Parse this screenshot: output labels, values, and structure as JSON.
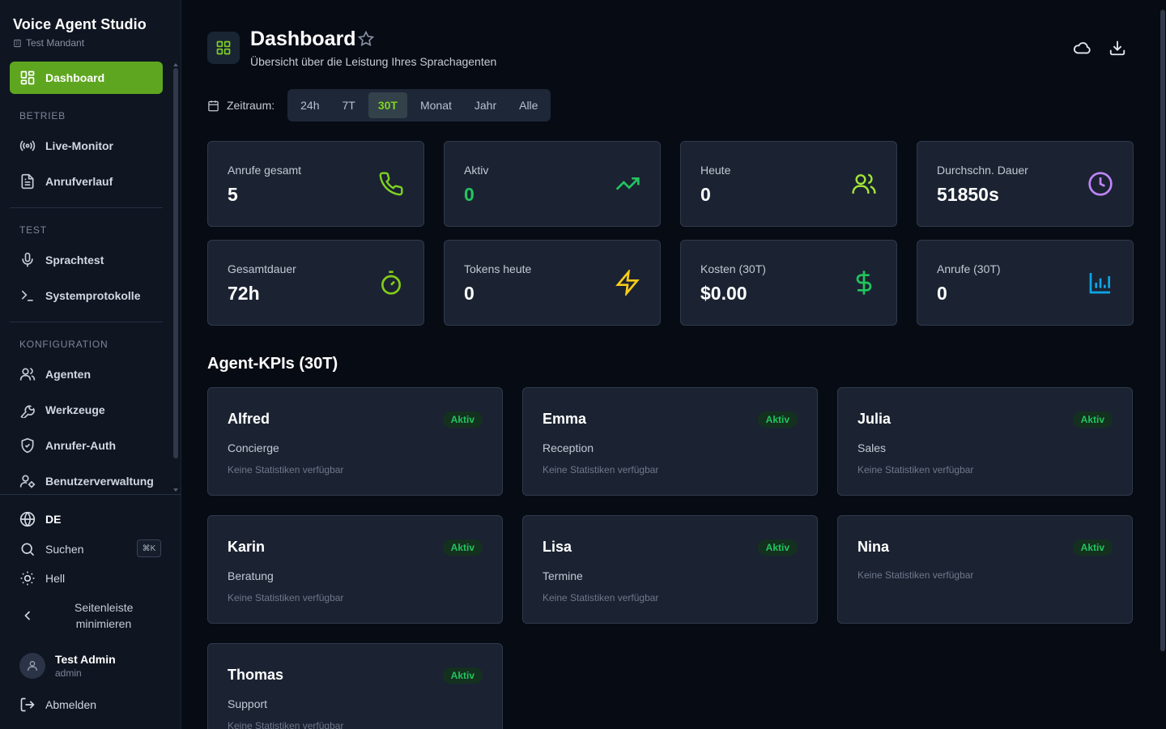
{
  "brand": {
    "title": "Voice Agent Studio",
    "tenant": "Test Mandant"
  },
  "nav": {
    "dashboard": "Dashboard",
    "sections": [
      {
        "title": "BETRIEB",
        "items": [
          "Live-Monitor",
          "Anrufverlauf"
        ]
      },
      {
        "title": "TEST",
        "items": [
          "Sprachtest",
          "Systemprotokolle"
        ]
      },
      {
        "title": "KONFIGURATION",
        "items": [
          "Agenten",
          "Werkzeuge",
          "Anrufer-Auth",
          "Benutzerverwaltung"
        ]
      }
    ]
  },
  "sidebar_bottom": {
    "language": "DE",
    "search": "Suchen",
    "shortcut": "⌘K",
    "theme": "Hell",
    "collapse": "Seitenleiste minimieren",
    "user_name": "Test Admin",
    "user_role": "admin",
    "logout": "Abmelden"
  },
  "header": {
    "title": "Dashboard",
    "subtitle": "Übersicht über die Leistung Ihres Sprachagenten"
  },
  "range": {
    "label": "Zeitraum:",
    "options": [
      "24h",
      "7T",
      "30T",
      "Monat",
      "Jahr",
      "Alle"
    ],
    "selected": "30T"
  },
  "stats": [
    {
      "label": "Anrufe gesamt",
      "value": "5",
      "icon": "phone-icon",
      "color": "#7ed321"
    },
    {
      "label": "Aktiv",
      "value": "0",
      "icon": "trending-up-icon",
      "color": "#22c55e"
    },
    {
      "label": "Heute",
      "value": "0",
      "icon": "users-icon",
      "color": "#a3e635"
    },
    {
      "label": "Durchschn. Dauer",
      "value": "51850s",
      "icon": "clock-icon",
      "color": "#c084fc"
    },
    {
      "label": "Gesamtdauer",
      "value": "72h",
      "icon": "timer-icon",
      "color": "#84cc16"
    },
    {
      "label": "Tokens heute",
      "value": "0",
      "icon": "zap-icon",
      "color": "#facc15"
    },
    {
      "label": "Kosten (30T)",
      "value": "$0.00",
      "icon": "dollar-icon",
      "color": "#22c55e"
    },
    {
      "label": "Anrufe (30T)",
      "value": "0",
      "icon": "bar-chart-icon",
      "color": "#0ea5e9"
    }
  ],
  "agents_section": {
    "title": "Agent-KPIs (30T)"
  },
  "agents": [
    {
      "name": "Alfred",
      "status": "Aktiv",
      "role": "Concierge",
      "note": "Keine Statistiken verfügbar"
    },
    {
      "name": "Emma",
      "status": "Aktiv",
      "role": "Reception",
      "note": "Keine Statistiken verfügbar"
    },
    {
      "name": "Julia",
      "status": "Aktiv",
      "role": "Sales",
      "note": "Keine Statistiken verfügbar"
    },
    {
      "name": "Karin",
      "status": "Aktiv",
      "role": "Beratung",
      "note": "Keine Statistiken verfügbar"
    },
    {
      "name": "Lisa",
      "status": "Aktiv",
      "role": "Termine",
      "note": "Keine Statistiken verfügbar"
    },
    {
      "name": "Nina",
      "status": "Aktiv",
      "role": "",
      "note": "Keine Statistiken verfügbar"
    },
    {
      "name": "Thomas",
      "status": "Aktiv",
      "role": "Support",
      "note": "Keine Statistiken verfügbar"
    }
  ]
}
